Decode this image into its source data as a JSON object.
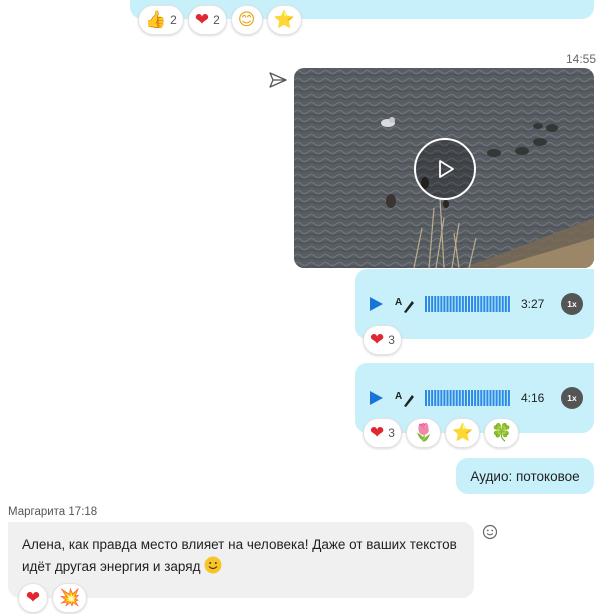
{
  "top_message": {
    "reactions": [
      {
        "emoji": "👍",
        "count": "2",
        "name": "thumbs-up"
      },
      {
        "emoji": "❤",
        "count": "2",
        "name": "heart"
      },
      {
        "emoji": "😊",
        "count": "",
        "name": "smile"
      },
      {
        "emoji": "⭐",
        "count": "",
        "name": "star"
      }
    ]
  },
  "video_message": {
    "time": "14:55"
  },
  "audio_messages": [
    {
      "duration": "3:27",
      "speed": "1x",
      "reactions": [
        {
          "emoji": "❤",
          "count": "3",
          "name": "heart"
        }
      ]
    },
    {
      "duration": "4:16",
      "speed": "1x",
      "reactions": [
        {
          "emoji": "❤",
          "count": "3",
          "name": "heart"
        },
        {
          "emoji": "🌷",
          "count": "",
          "name": "tulip"
        },
        {
          "emoji": "⭐",
          "count": "",
          "name": "star"
        },
        {
          "emoji": "🍀",
          "count": "",
          "name": "clover"
        }
      ]
    }
  ],
  "outgoing_text": "Аудио: потоковое",
  "incoming": {
    "sender": "Маргарита",
    "time": "17:18",
    "line1": "Алена, как правда место влияет на человека! Даже от ваших текстов",
    "line2": "идёт другая энергия и заряд",
    "reactions": [
      {
        "emoji": "❤",
        "count": "",
        "name": "heart"
      },
      {
        "emoji": "💥",
        "count": "",
        "name": "collision"
      }
    ]
  },
  "colors": {
    "bubble_out": "#c7f0fb",
    "bubble_in": "#f0f0f0",
    "accent": "#1a73d9",
    "heart": "#e0262e"
  }
}
